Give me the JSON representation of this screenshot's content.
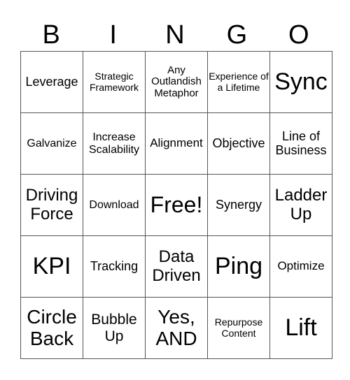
{
  "header": {
    "letters": [
      "B",
      "I",
      "N",
      "G",
      "O"
    ]
  },
  "rows": [
    [
      "Leverage",
      "Strategic Framework",
      "Any Outlandish Metaphor",
      "Experience of a Lifetime",
      "Sync"
    ],
    [
      "Galvanize",
      "Increase Scalability",
      "Alignment",
      "Objective",
      "Line of Business"
    ],
    [
      "Driving Force",
      "Download",
      "Free!",
      "Synergy",
      "Ladder Up"
    ],
    [
      "KPI",
      "Tracking",
      "Data Driven",
      "Ping",
      "Optimize"
    ],
    [
      "Circle Back",
      "Bubble Up",
      "Yes, AND",
      "Repurpose Content",
      "Lift"
    ]
  ]
}
